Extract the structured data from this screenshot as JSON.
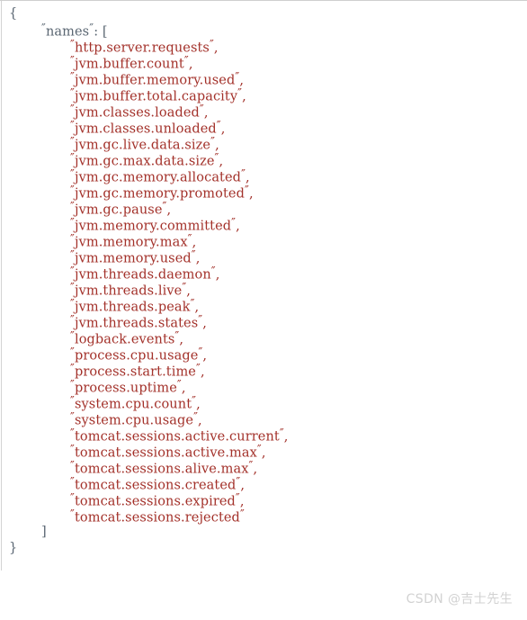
{
  "document": {
    "type": "json-code-block",
    "language": "json",
    "open_brace": "{",
    "close_brace": "}",
    "open_bracket": "[",
    "close_bracket": "]",
    "quote_glyph": "″",
    "colon": ":",
    "comma": ",",
    "key_label": "names",
    "colors": {
      "punctuation": "#5a6672",
      "key": "#5a6672",
      "string": "#a3312a",
      "background": "#ffffff",
      "rule": "#cfcfcf",
      "watermark": "#d2d2d2"
    },
    "names": [
      "http.server.requests",
      "jvm.buffer.count",
      "jvm.buffer.memory.used",
      "jvm.buffer.total.capacity",
      "jvm.classes.loaded",
      "jvm.classes.unloaded",
      "jvm.gc.live.data.size",
      "jvm.gc.max.data.size",
      "jvm.gc.memory.allocated",
      "jvm.gc.memory.promoted",
      "jvm.gc.pause",
      "jvm.memory.committed",
      "jvm.memory.max",
      "jvm.memory.used",
      "jvm.threads.daemon",
      "jvm.threads.live",
      "jvm.threads.peak",
      "jvm.threads.states",
      "logback.events",
      "process.cpu.usage",
      "process.start.time",
      "process.uptime",
      "system.cpu.count",
      "system.cpu.usage",
      "tomcat.sessions.active.current",
      "tomcat.sessions.active.max",
      "tomcat.sessions.alive.max",
      "tomcat.sessions.created",
      "tomcat.sessions.expired",
      "tomcat.sessions.rejected"
    ]
  },
  "watermark": {
    "text": "CSDN @吉士先生"
  }
}
